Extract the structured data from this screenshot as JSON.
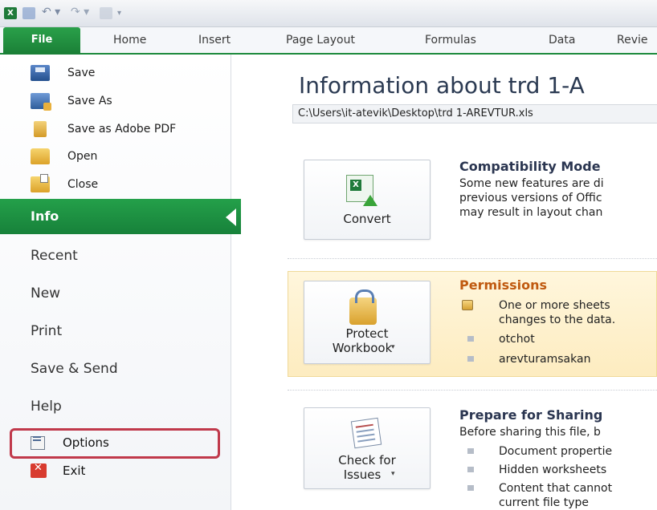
{
  "ribbon": {
    "tabs": [
      "File",
      "Home",
      "Insert",
      "Page Layout",
      "Formulas",
      "Data",
      "Revie"
    ]
  },
  "backstage": {
    "commands": [
      "Save",
      "Save As",
      "Save as Adobe PDF",
      "Open",
      "Close"
    ],
    "selected": "Info",
    "items": [
      "Recent",
      "New",
      "Print",
      "Save & Send",
      "Help"
    ],
    "options": "Options",
    "exit": "Exit"
  },
  "info": {
    "title": "Information about trd 1-A",
    "path": "C:\\Users\\it-atevik\\Desktop\\trd 1-AREVTUR.xls",
    "compatibility": {
      "button": "Convert",
      "heading": "Compatibility Mode",
      "lines": [
        "Some new features are di",
        "previous versions of Offic",
        "may result in layout chan"
      ]
    },
    "permissions": {
      "button_line1": "Protect",
      "button_line2": "Workbook",
      "heading": "Permissions",
      "lines": [
        "One or more sheets",
        "changes to the data."
      ],
      "users": [
        "otchot",
        "arevturamsakan"
      ]
    },
    "prepare": {
      "button_line1": "Check for",
      "button_line2": "Issues",
      "heading": "Prepare for Sharing",
      "intro": "Before sharing this file, b",
      "items": [
        "Document propertie",
        "Hidden worksheets",
        "Content that cannot"
      ],
      "tail": "current file type"
    }
  },
  "colors": {
    "file_tab": "#1d8a3c",
    "info_band": "#1f9343",
    "permission_heading": "#c05a10",
    "highlight_box": "#c0394b"
  }
}
